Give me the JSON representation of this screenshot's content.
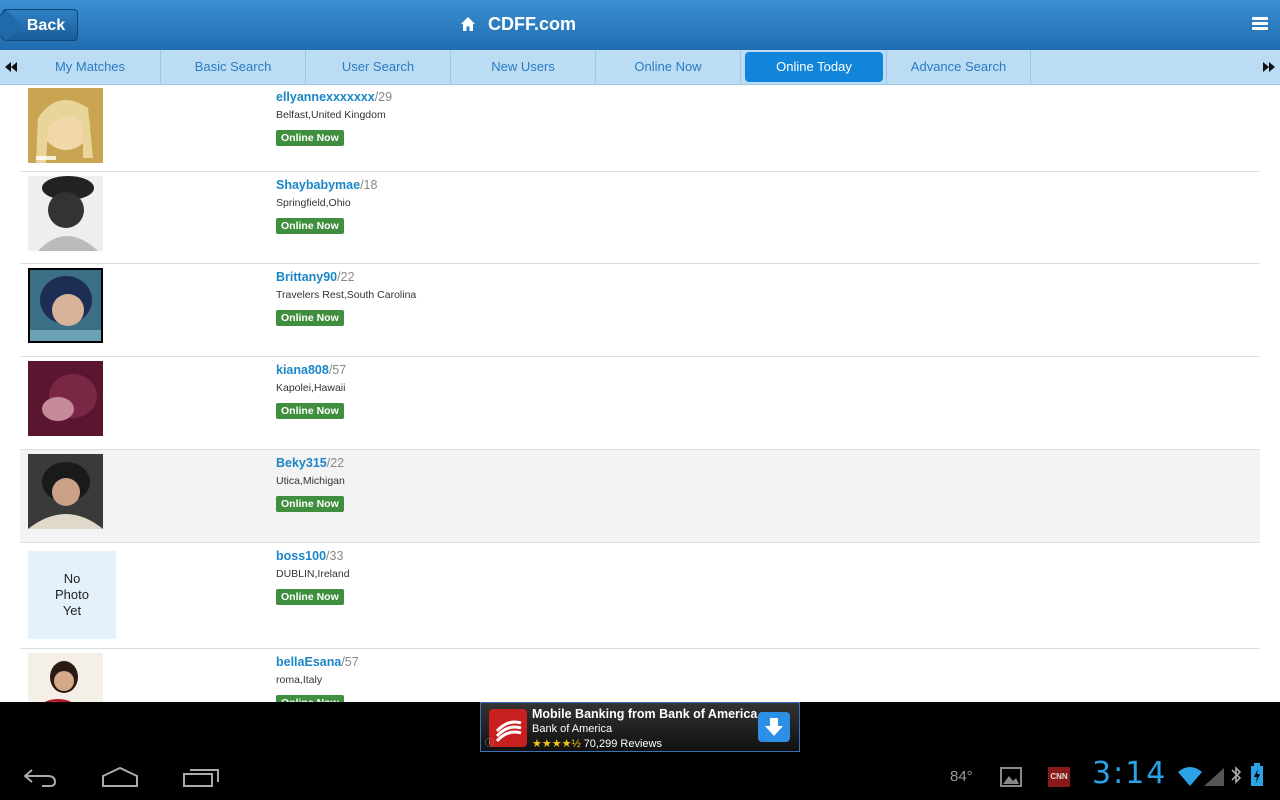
{
  "header": {
    "back_label": "Back",
    "site_title": "CDFF.com"
  },
  "tabs": [
    {
      "label": "My Matches"
    },
    {
      "label": "Basic Search"
    },
    {
      "label": "User Search"
    },
    {
      "label": "New Users"
    },
    {
      "label": "Online Now"
    },
    {
      "label": "Online Today"
    },
    {
      "label": "Advance Search"
    }
  ],
  "active_tab": "Online Today",
  "users": [
    {
      "name": "ellyannexxxxxxx",
      "age": "/29",
      "location": "Belfast,United Kingdom",
      "status": "Online Now"
    },
    {
      "name": "Shaybabymae",
      "age": "/18",
      "location": "Springfield,Ohio",
      "status": "Online Now"
    },
    {
      "name": "Brittany90",
      "age": "/22",
      "location": "Travelers Rest,South Carolina",
      "status": "Online Now"
    },
    {
      "name": "kiana808",
      "age": "/57",
      "location": "Kapolei,Hawaii",
      "status": "Online Now"
    },
    {
      "name": "Beky315",
      "age": "/22",
      "location": "Utica,Michigan",
      "status": "Online Now"
    },
    {
      "name": "boss100",
      "age": "/33",
      "location": "DUBLIN,Ireland",
      "status": "Online Now",
      "no_photo_text": "No Photo Yet"
    },
    {
      "name": "bellaEsana",
      "age": "/57",
      "location": "roma,Italy",
      "status": "Online Now"
    }
  ],
  "ad": {
    "title": "Mobile Banking from Bank of America",
    "advertiser": "Bank of America",
    "stars": "★★★★½",
    "reviews": "70,299 Reviews"
  },
  "status_bar": {
    "temperature": "84°",
    "time": "3:14"
  },
  "colors": {
    "header": "#1f6db1",
    "tab_bg": "#bcdcf3",
    "tab_active": "#1185d9",
    "username": "#1a86c8",
    "online_badge": "#3f8f3f",
    "clock": "#2aa3e6"
  }
}
